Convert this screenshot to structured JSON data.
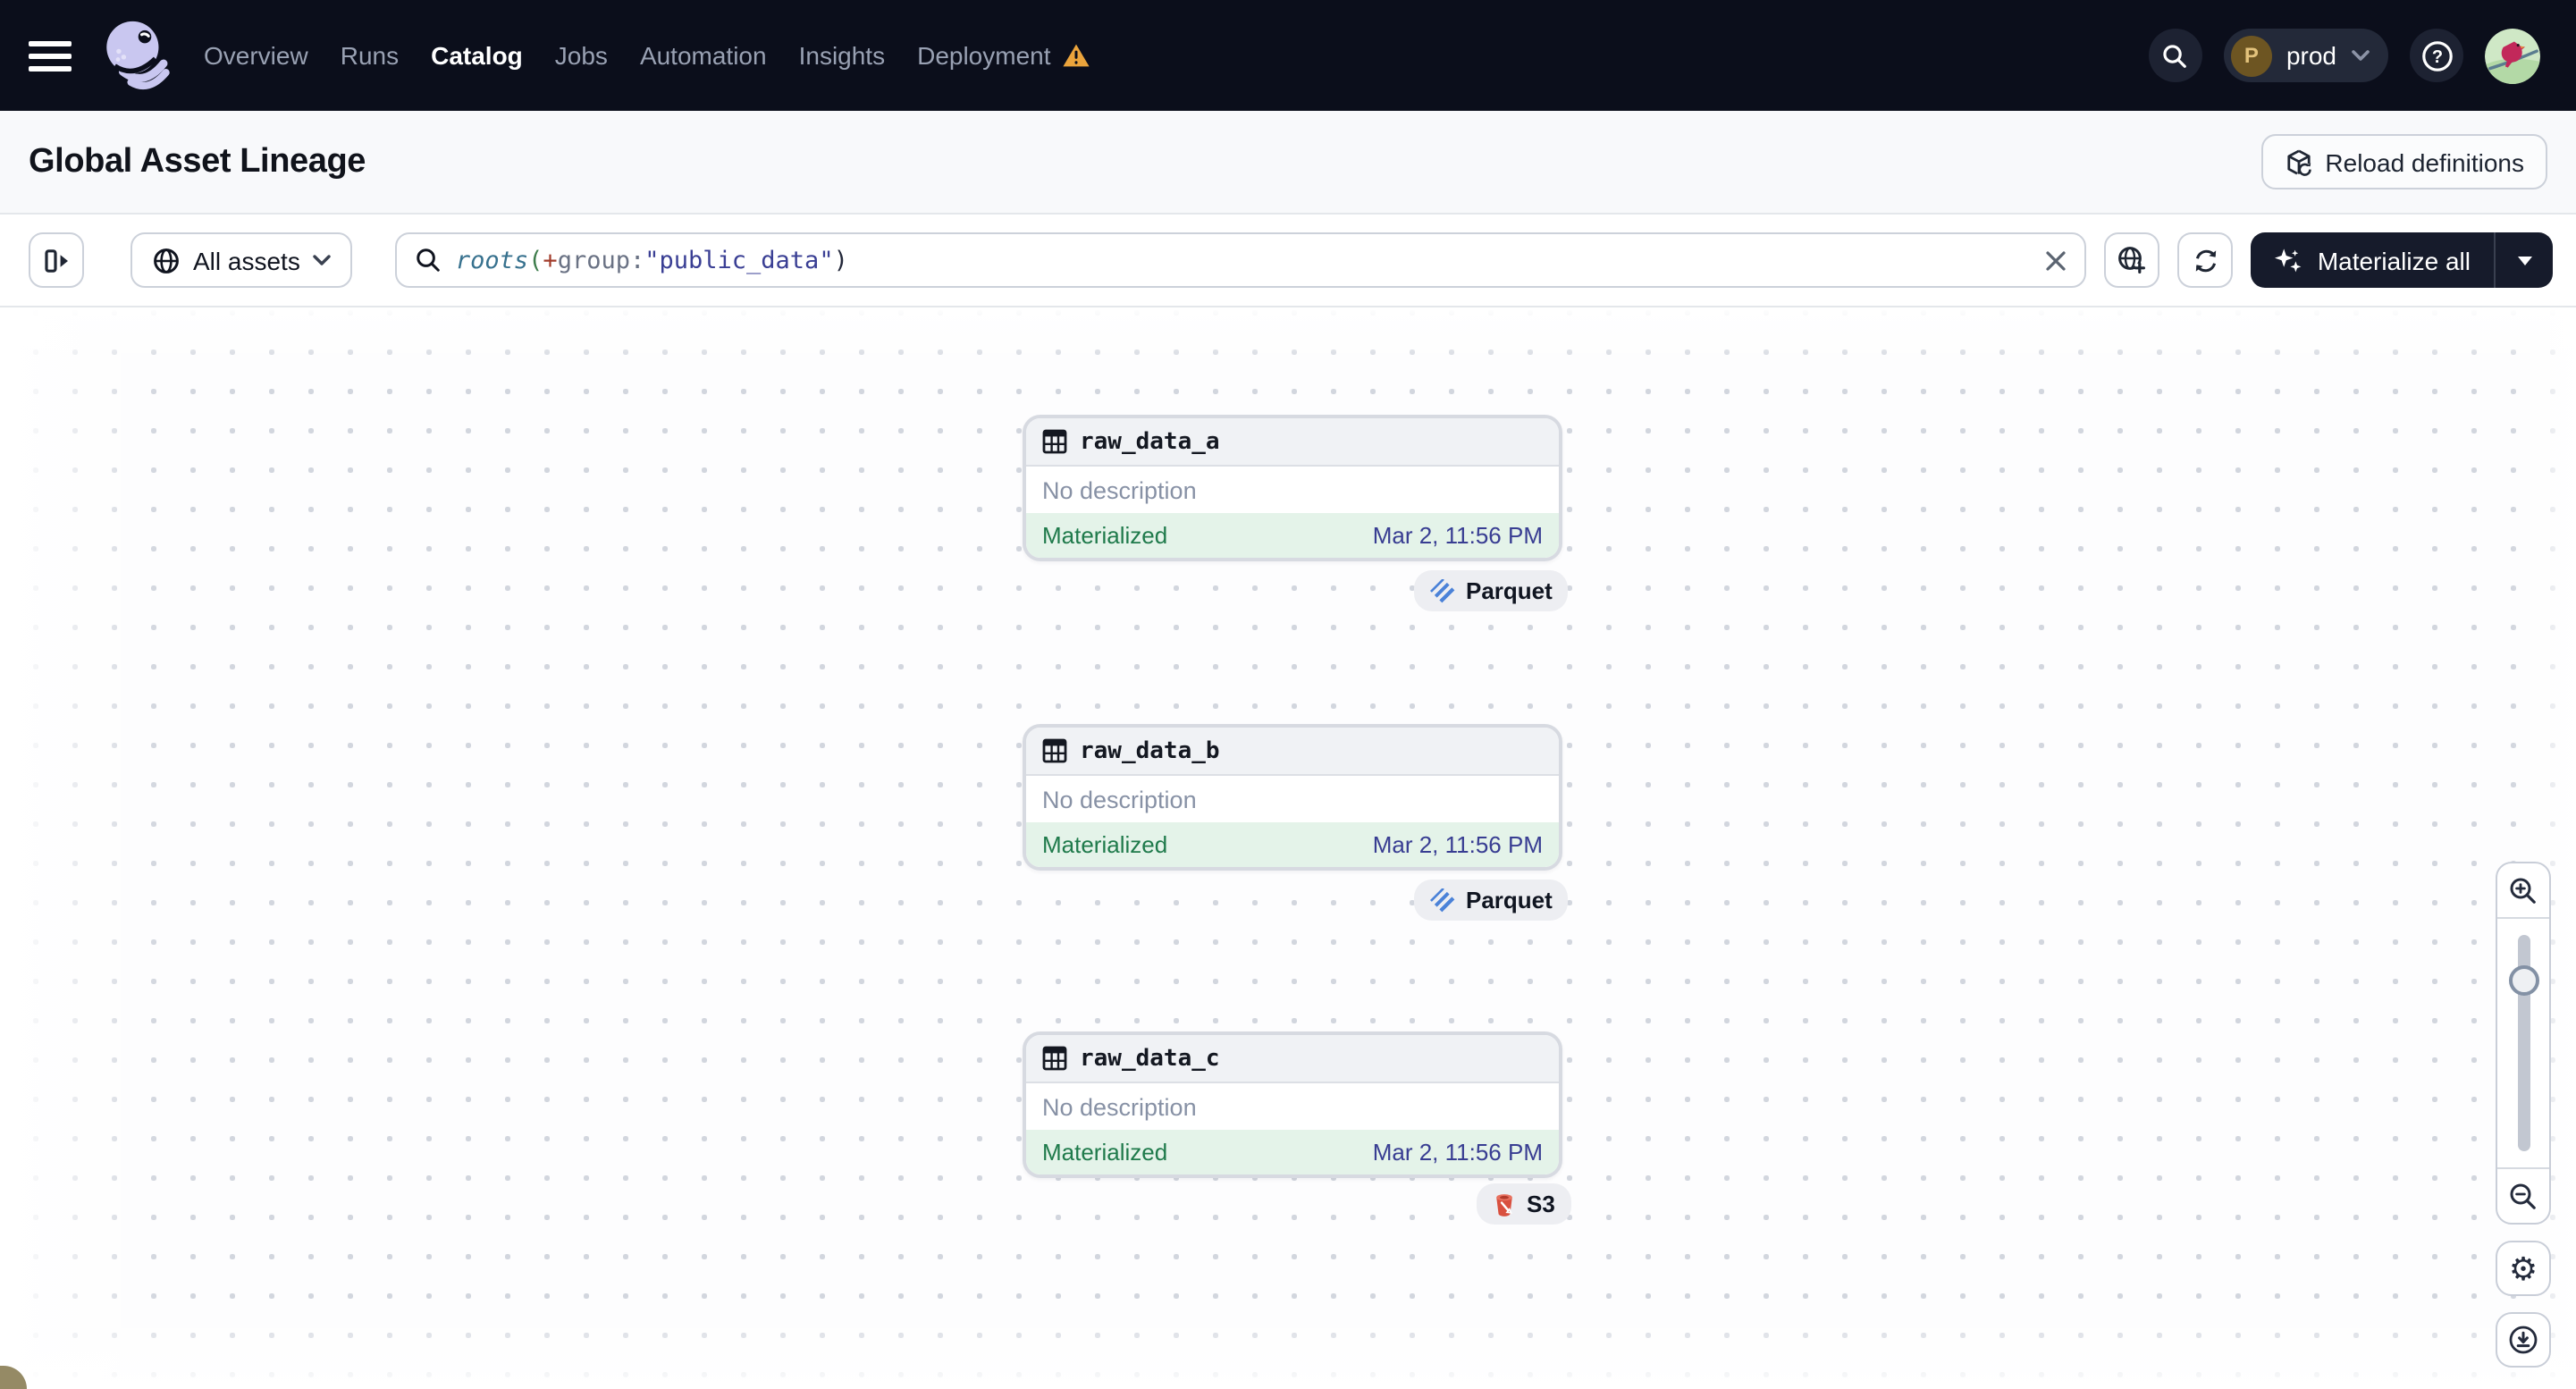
{
  "nav": {
    "items": [
      {
        "label": "Overview",
        "active": false
      },
      {
        "label": "Runs",
        "active": false
      },
      {
        "label": "Catalog",
        "active": true
      },
      {
        "label": "Jobs",
        "active": false
      },
      {
        "label": "Automation",
        "active": false
      },
      {
        "label": "Insights",
        "active": false
      },
      {
        "label": "Deployment",
        "active": false,
        "warning": true
      }
    ],
    "deployment_switcher": {
      "initial": "P",
      "label": "prod"
    }
  },
  "header": {
    "title": "Global Asset Lineage",
    "reload_button_label": "Reload definitions"
  },
  "toolbar": {
    "asset_filter_label": "All assets",
    "search_tokens": [
      {
        "text": "roots",
        "type": "function"
      },
      {
        "text": "(",
        "type": "paren_open"
      },
      {
        "text": "+",
        "type": "operator"
      },
      {
        "text": "group:",
        "type": "attribute"
      },
      {
        "text": "\"public_data\"",
        "type": "string"
      },
      {
        "text": ")",
        "type": "paren_close"
      }
    ],
    "materialize_button_label": "Materialize all"
  },
  "graph": {
    "nodes": [
      {
        "name": "raw_data_a",
        "description": "No description",
        "status": "Materialized",
        "materialized_at": "Mar 2, 11:56 PM",
        "storage_badge": "Parquet",
        "storage_icon": "parquet-icon"
      },
      {
        "name": "raw_data_b",
        "description": "No description",
        "status": "Materialized",
        "materialized_at": "Mar 2, 11:56 PM",
        "storage_badge": "Parquet",
        "storage_icon": "parquet-icon"
      },
      {
        "name": "raw_data_c",
        "description": "No description",
        "status": "Materialized",
        "materialized_at": "Mar 2, 11:56 PM",
        "storage_badge": "S3",
        "storage_icon": "s3-bucket-icon"
      }
    ]
  },
  "side_controls": {
    "icons": [
      "zoom-in-icon",
      "zoom-out-icon",
      "settings-gear-icon",
      "download-icon"
    ]
  },
  "colors": {
    "nav_bg": "#0b0e1b",
    "warning_orange": "#eba43c",
    "status_green": "#1f7a4b",
    "timestamp_indigo": "#383d92",
    "materialized_bg": "#e4f3e9",
    "query_function": "#37718e",
    "query_paren_open": "#3e7d4c",
    "query_operator": "#a23c2b",
    "query_attribute": "#6a7284",
    "query_string": "#3a3f94",
    "parquet_blue": "#4b82d8",
    "s3_red": "#d9503f"
  }
}
